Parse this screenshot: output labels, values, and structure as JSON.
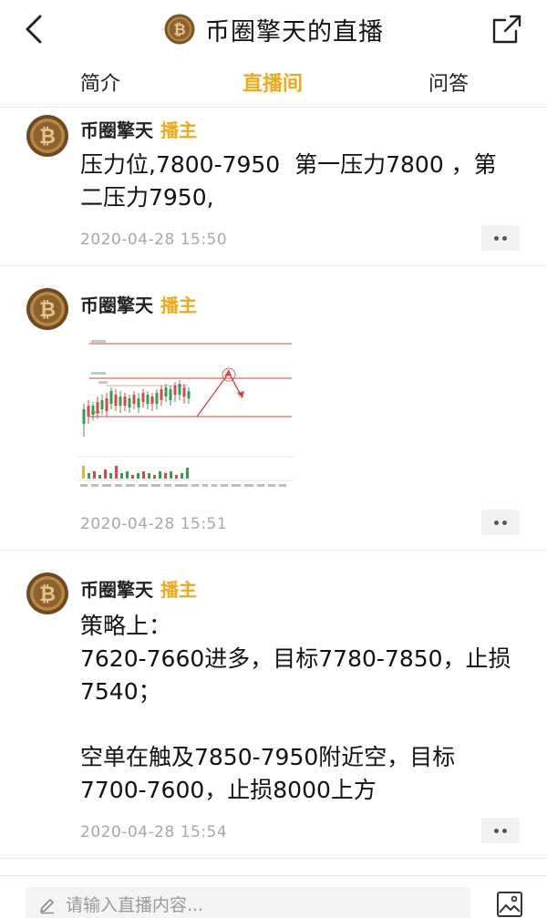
{
  "header": {
    "title": "币圈擎天的直播",
    "back_icon": "chevron-left-icon",
    "share_icon": "share-external-icon"
  },
  "tabs": [
    {
      "label": "简介",
      "active": false
    },
    {
      "label": "直播间",
      "active": true
    },
    {
      "label": "问答",
      "active": false
    }
  ],
  "colors": {
    "accent": "#f0a91c",
    "timestamp": "#a8a8a8",
    "divider": "#ececec"
  },
  "posts": [
    {
      "author": "币圈擎天",
      "role": "播主",
      "text": "压力位,7800-7950  第一压力7800 ，第二压力7950,",
      "time": "2020-04-28 15:50"
    },
    {
      "author": "币圈擎天",
      "role": "播主",
      "image": "candlestick-chart-screenshot",
      "time": "2020-04-28 15:51"
    },
    {
      "author": "币圈擎天",
      "role": "播主",
      "text": "策略上：\n7620-7660进多，目标7780-7850，止损7540；\n\n空单在触及7850-7950附近空，目标7700-7600，止损8000上方",
      "time": "2020-04-28 15:54"
    }
  ],
  "composer": {
    "placeholder": "请输入直播内容...",
    "pencil_icon": "pencil-icon",
    "image_icon": "image-icon"
  }
}
